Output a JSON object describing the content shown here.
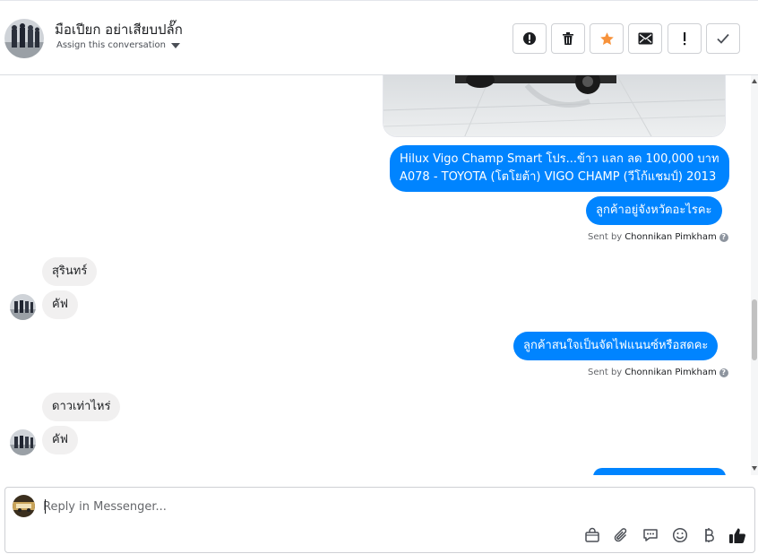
{
  "header": {
    "contact_name": "มือเปียก อย่าเสียบปลั๊ก",
    "assign_label": "Assign this conversation",
    "actions": [
      {
        "icon": "alert-circle-icon",
        "label": "mark-spam"
      },
      {
        "icon": "trash-icon",
        "label": "delete"
      },
      {
        "icon": "star-icon",
        "label": "star"
      },
      {
        "icon": "envelope-icon",
        "label": "mark-unread"
      },
      {
        "icon": "exclamation-icon",
        "label": "follow-up"
      },
      {
        "icon": "checkmark-icon",
        "label": "done"
      }
    ],
    "star_color": "#f7923b"
  },
  "thread": {
    "outgoing_color": "#0084ff",
    "incoming_color": "#f1f0f0",
    "messages": [
      {
        "direction": "out",
        "line1": "Hilux Vigo Champ Smart โปร...ข้าว แลก ลด 100,000 บาท",
        "line2": "A078 - TOYOTA (โตโยต้า) VIGO CHAMP (วีโก้แชมป์) 2013"
      },
      {
        "direction": "out",
        "text": "ลูกค้าอยู่จังหวัดอะไรคะ"
      },
      {
        "direction": "in",
        "text": "สุรินทร์"
      },
      {
        "direction": "in",
        "text": "คัฟ"
      },
      {
        "direction": "out",
        "text": "ลูกค้าสนใจเป็นจัดไฟแนนซ์หรือสดคะ"
      },
      {
        "direction": "in",
        "text": "ดาวเท่าไหร่"
      },
      {
        "direction": "in",
        "text": "คัฟ"
      }
    ],
    "sent_by": [
      {
        "prefix": "Sent by",
        "agent": "Chonnikan Pimkham"
      },
      {
        "prefix": "Sent by",
        "agent": "Chonnikan Pimkham"
      }
    ]
  },
  "composer": {
    "placeholder": "Reply in Messenger...",
    "tools": [
      "bag-icon",
      "paperclip-icon",
      "saved-replies-icon",
      "emoji-icon",
      "baht-icon",
      "thumbs-up-icon"
    ],
    "like_color": "#1c1e21"
  }
}
